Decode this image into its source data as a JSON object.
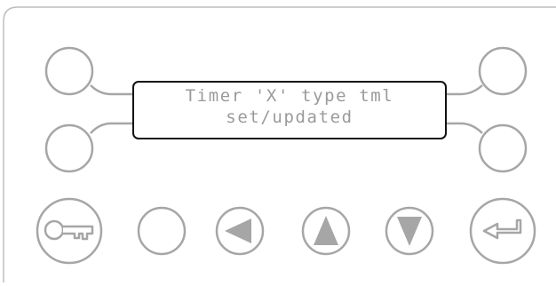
{
  "display": {
    "line1": "Timer 'X' type tml",
    "line2": "set/updated"
  },
  "softkeys": [
    {
      "id": "top-left"
    },
    {
      "id": "bottom-left"
    },
    {
      "id": "top-right"
    },
    {
      "id": "bottom-right"
    }
  ],
  "keypad": [
    {
      "name": "key-button",
      "icon": "key-icon"
    },
    {
      "name": "blank-button",
      "icon": ""
    },
    {
      "name": "left-arrow-button",
      "icon": "left-arrow-icon"
    },
    {
      "name": "up-arrow-button",
      "icon": "up-arrow-icon"
    },
    {
      "name": "down-arrow-button",
      "icon": "down-arrow-icon"
    },
    {
      "name": "enter-button",
      "icon": "enter-icon"
    }
  ],
  "colors": {
    "panel_border": "#bdbdbd",
    "button_outline": "#a6a6a6",
    "icon_fill": "#a6a6a6",
    "lcd_border": "#111111",
    "lcd_text": "#9a9a9a"
  }
}
